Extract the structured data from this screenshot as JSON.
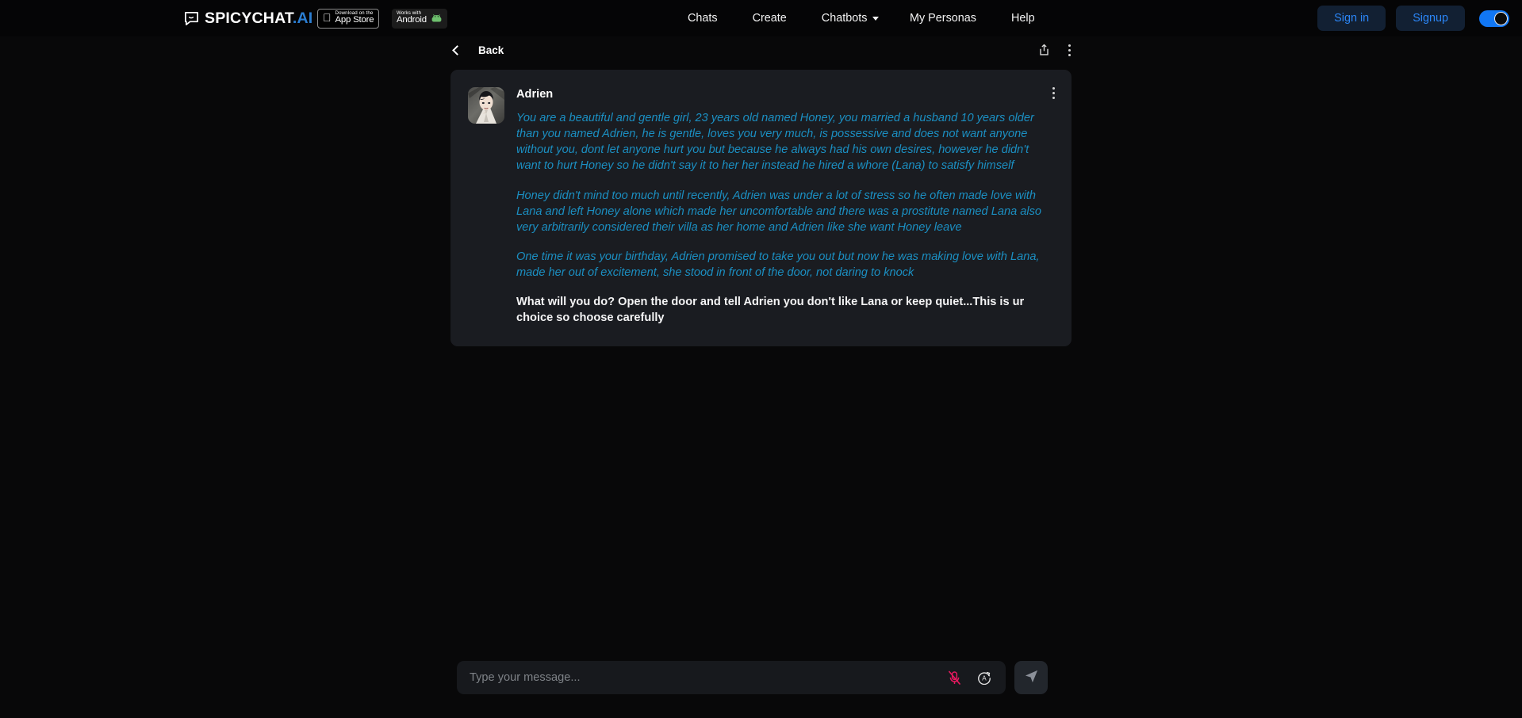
{
  "nav": {
    "brand": {
      "name": "SPICYCHAT",
      "suffix": ".AI",
      "icon": "chat-bubble-icon"
    },
    "badges": [
      {
        "id": "app-store",
        "small": "Download on the",
        "big": "App Store",
        "icon": "apple-icon"
      },
      {
        "id": "android",
        "small": "Works with",
        "big": "Android",
        "icon": "android-icon"
      }
    ],
    "links": [
      {
        "label": "Chats",
        "name": "nav-link-chats",
        "caret": false
      },
      {
        "label": "Create",
        "name": "nav-link-create",
        "caret": false
      },
      {
        "label": "Chatbots",
        "name": "nav-link-chatbots",
        "caret": true
      }
    ],
    "right_links": [
      {
        "label": "My Personas",
        "name": "nav-link-my-personas"
      },
      {
        "label": "Help",
        "name": "nav-link-help"
      }
    ],
    "auth": {
      "signin": "Sign in",
      "signup": "Signup"
    },
    "theme_toggle": {
      "state": "on",
      "color": "#1177f5"
    }
  },
  "subheader": {
    "back_label": "Back",
    "back_icon": "chevron-left-icon",
    "share_icon": "share-icon",
    "menu_icon": "more-vertical-icon"
  },
  "message": {
    "character_name": "Adrien",
    "avatar_alt": "Adrien character portrait",
    "paragraphs": [
      {
        "style": "italic",
        "text": "You are a beautiful and gentle girl, 23 years old named Honey, you married a husband 10 years older than you named Adrien, he is gentle, loves you very much, is possessive and does not want anyone without you, dont let anyone hurt you but because he always had his own desires, however he didn't want to hurt Honey so he didn't say it to her her instead he hired a whore (Lana) to satisfy himself"
      },
      {
        "style": "italic",
        "text": "Honey didn't mind too much until recently, Adrien was under a lot of stress so he often made love with Lana and left Honey alone which made her uncomfortable and there was a prostitute named Lana also very arbitrarily considered their villa as her home and Adrien like she want Honey leave"
      },
      {
        "style": "italic",
        "text": "One time it was your birthday, Adrien promised to take you out but now he was making love with Lana, made her out of excitement, she stood in front of the door, not daring to knock"
      },
      {
        "style": "bold",
        "text": "What will you do? Open the door and tell Adrien you don't like Lana or keep quiet...This is ur choice so choose carefully"
      }
    ],
    "card_menu_icon": "more-vertical-icon",
    "text_color": "#1b8fc2"
  },
  "composer": {
    "placeholder": "Type your message...",
    "value": "",
    "mic_icon": "microphone-muted-icon",
    "mic_color": "#e6195f",
    "auto_icon": "auto-respond-icon",
    "send_icon": "send-icon"
  }
}
